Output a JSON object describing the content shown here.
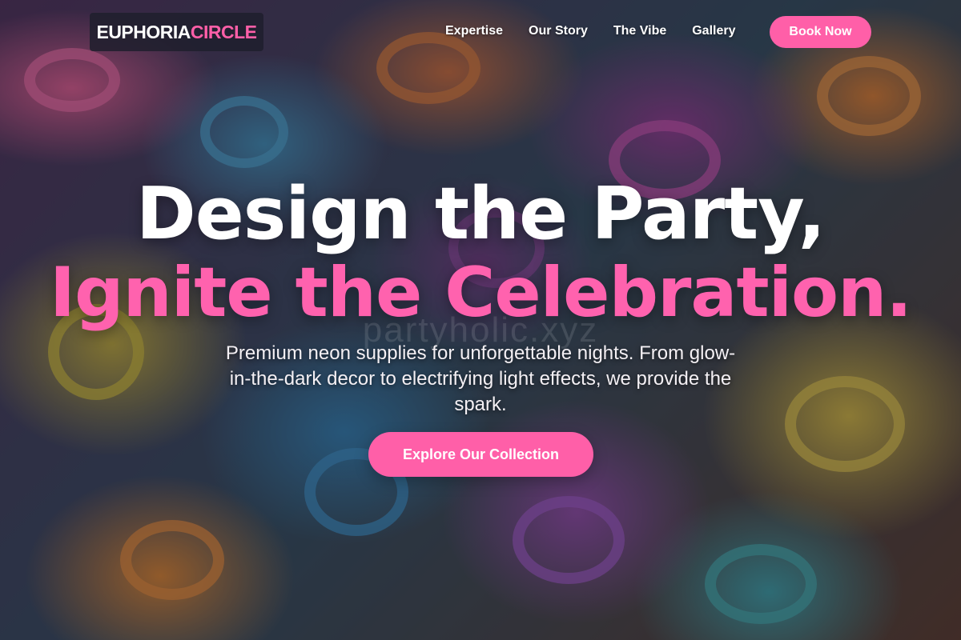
{
  "brand": {
    "logo_part1": "EUPHORIA",
    "logo_part2": "CIRCLE"
  },
  "nav": {
    "links": [
      "Expertise",
      "Our Story",
      "The Vibe",
      "Gallery"
    ],
    "cta_label": "Book Now"
  },
  "hero": {
    "headline_line1": "Design the Party,",
    "headline_line2": "Ignite the Celebration.",
    "subtext": "Premium neon supplies for unforgettable nights. From glow-in-the-dark decor to electrifying light effects, we provide the spark.",
    "cta_label": "Explore Our Collection",
    "watermark": "partyholic.xyz"
  },
  "colors": {
    "accent": "#ff5fa8",
    "headline_white": "#ffffff",
    "headline_pink": "#ff62ae",
    "logo_bg": "#1e1e2d"
  }
}
